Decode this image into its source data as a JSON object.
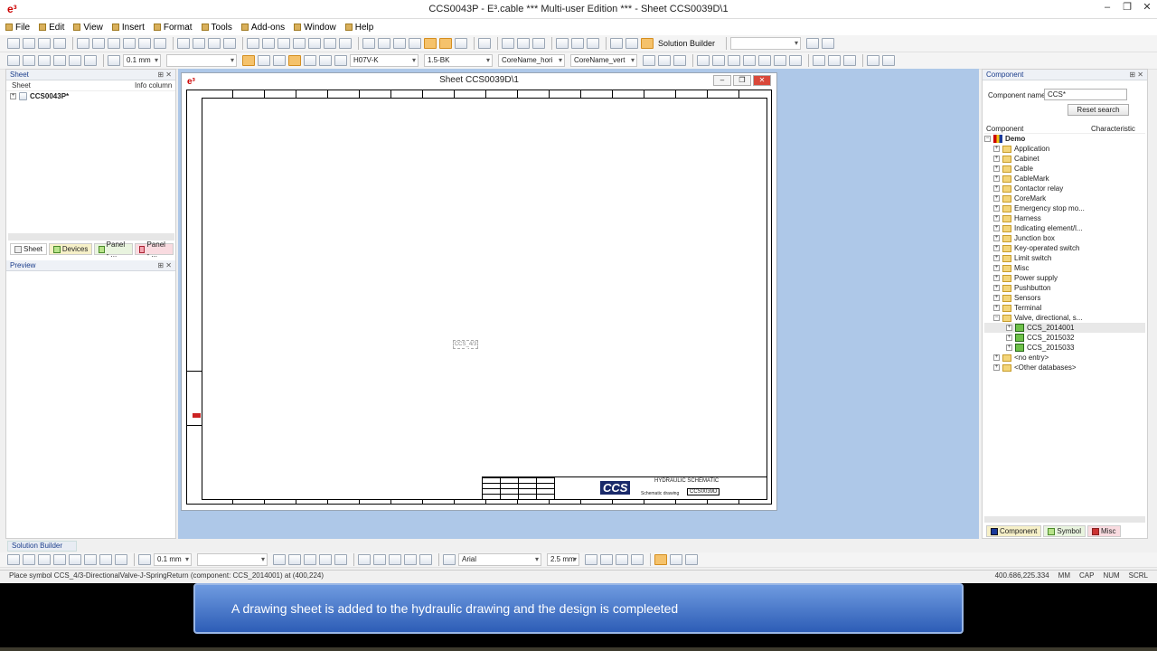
{
  "app": {
    "title": "CCS0043P - E³.cable *** Multi-user Edition *** - Sheet CCS0039D\\1",
    "logo": "e³",
    "window_buttons": [
      "–",
      "❐",
      "✕"
    ]
  },
  "menu": [
    "File",
    "Edit",
    "View",
    "Insert",
    "Format",
    "Tools",
    "Add-ons",
    "Window",
    "Help"
  ],
  "toolbar1": {
    "solution_builder_label": "Solution Builder"
  },
  "toolbar2": {
    "line_width": "0.1 mm",
    "cable_type": "H07V-K",
    "wire": "1.5-BK",
    "core_name_hori": "CoreName_hori",
    "core_name_vert": "CoreName_vert"
  },
  "left_panel": {
    "title": "Sheet",
    "col_sheet": "Sheet",
    "col_info": "Info column",
    "tree_root": "CCS0043P*",
    "tabs": [
      "Sheet",
      "Devices",
      "Panel - ...",
      "Panel - ..."
    ],
    "preview_title": "Preview"
  },
  "sheet_window": {
    "title": "Sheet CCS0039D\\1",
    "title_block": {
      "brand": "CCS",
      "heading": "HYDRAULIC SCHEMATIC",
      "drawing_no": "CCS0039D",
      "sub": "Schematic drawing"
    },
    "ghost_symbol": "CCS_4/3"
  },
  "right_panel": {
    "title": "Component",
    "component_name_label": "Component name",
    "component_name_value": "CCS*",
    "reset_button": "Reset search",
    "col_component": "Component",
    "col_characteristic": "Characteristic",
    "root": "Demo",
    "folders": [
      "Application",
      "Cabinet",
      "Cable",
      "CableMark",
      "Contactor relay",
      "CoreMark",
      "Emergency stop mo...",
      "Harness",
      "Indicating element/l...",
      "Junction box",
      "Key-operated switch",
      "Limit switch",
      "Misc",
      "Power supply",
      "Pushbutton",
      "Sensors",
      "Terminal",
      "Valve, directional, s..."
    ],
    "valve_children": [
      "CCS_2014001",
      "CCS_2015032",
      "CCS_2015033"
    ],
    "extra": [
      "<no entry>",
      "<Other databases>"
    ],
    "tabs": [
      "Component",
      "Symbol",
      "Misc"
    ]
  },
  "bottom": {
    "solution_builder": "Solution Builder",
    "line_width": "0.1 mm",
    "font": "Arial",
    "font_size": "2.5 mm"
  },
  "status": {
    "message": "Place symbol CCS_4/3-DirectionalValve-J-SpringReturn (component: CCS_2014001) at (400,224)",
    "coords": "400.686,225.334",
    "unit": "MM",
    "cap": "CAP",
    "num": "NUM",
    "scrl": "SCRL"
  },
  "caption": {
    "text": "A drawing sheet is added to the hydraulic drawing and the design is compleeted"
  },
  "colors": {
    "workspace": "#aec8e8",
    "caption": "#2d5db6",
    "accent": "#1c3e8c"
  }
}
